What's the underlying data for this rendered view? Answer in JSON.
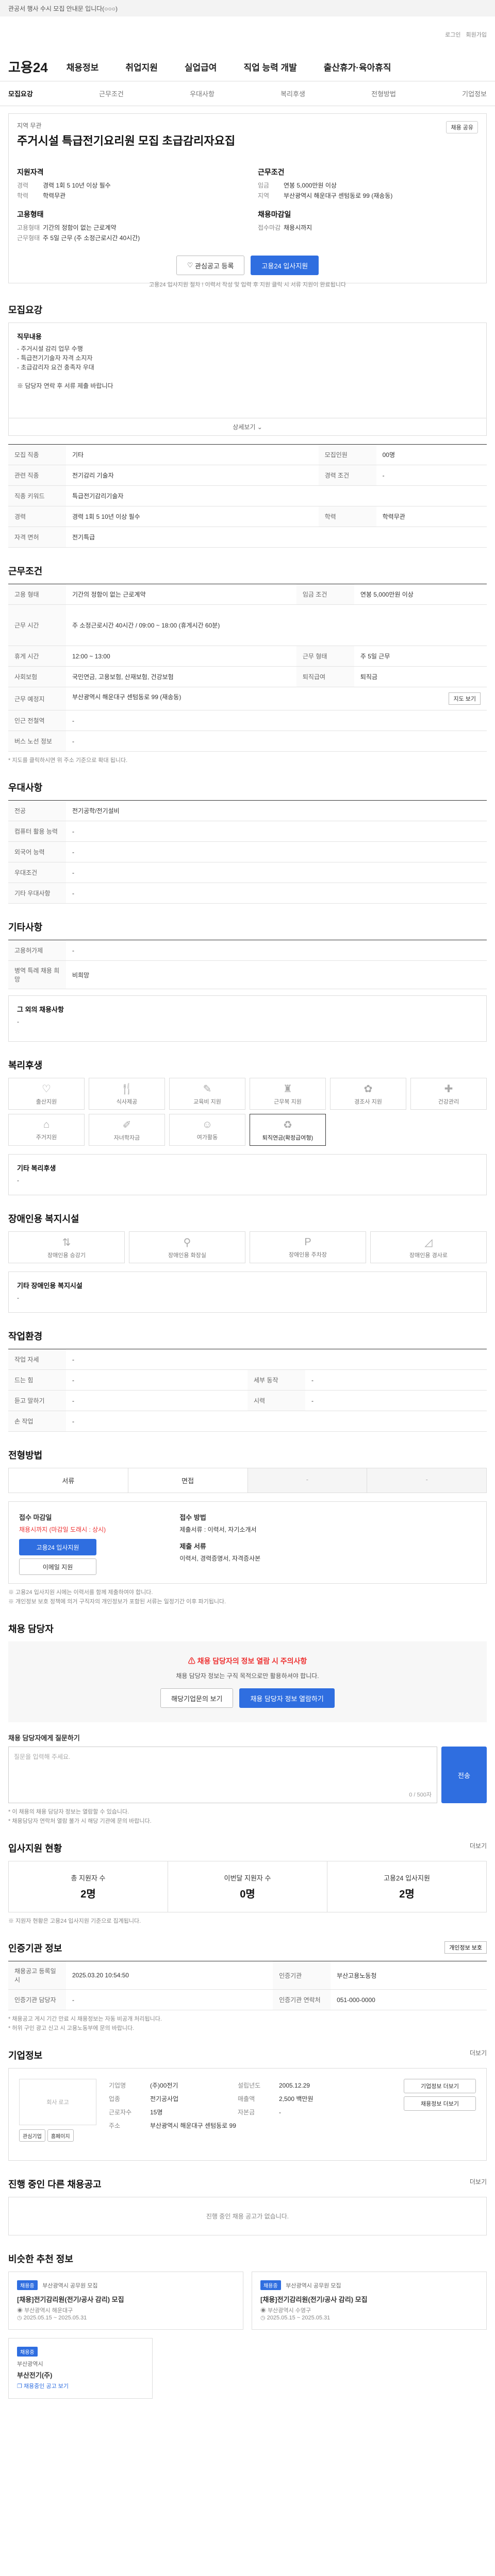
{
  "top": {
    "notice": "관공서 행사 수시 모집 안내문 입니다(○○○)",
    "util": [
      "로그인",
      "회원가입"
    ]
  },
  "gnb": {
    "logo": "고용24",
    "items": [
      "채용정보",
      "취업지원",
      "실업급여",
      "직업 능력 개발",
      "출산휴가·육아휴직"
    ]
  },
  "tabs": [
    "모집요강",
    "근무조건",
    "우대사항",
    "복리후생",
    "전형방법",
    "기업정보"
  ],
  "job": {
    "tag": "지역 무관",
    "share": "채용 공유",
    "title": "주거시설 특급전기요리원 모집 초급감리자요집",
    "left_title": "지원자격",
    "left": [
      {
        "k": "경력",
        "v": "경력 1회 5 10년 이상 필수"
      },
      {
        "k": "학력",
        "v": "학력무관"
      }
    ],
    "left_title2": "고용형태",
    "left2": [
      {
        "k": "고용형태",
        "v": "기간의 정함이 없는 근로계약"
      },
      {
        "k": "근무형태",
        "v": "주 5일 근무 (주 소정근로시간 40시간)"
      }
    ],
    "right_title": "근무조건",
    "right": [
      {
        "k": "임금",
        "v": "연봉 5,000만원 이상"
      },
      {
        "k": "지역",
        "v": "부산광역시 해운대구 센텀동로 99 (재송동)"
      }
    ],
    "right_title2": "채용마감일",
    "right2": [
      {
        "k": "접수마감",
        "v": "채용시까지"
      }
    ],
    "btn_fav": "관심공고 등록",
    "btn_apply": "고용24 입사지원",
    "hint": "고용24 입사지원 절차 ! 이력서 작성 및 입력 후 지원 클릭 시 서류 지원이 완료됩니다"
  },
  "recruit": {
    "title": "모집요강",
    "desc_head": "직무내용",
    "desc": "- 주거시설 감리 업무 수행\n- 특급전기기술자 자격 소지자\n- 초급감리자 요건 충족자 우대\n\n※ 담당자 연락 후 서류 제출 바랍니다",
    "more": "상세보기",
    "rows": [
      [
        "모집 직종",
        "기타",
        "모집인원",
        "00명"
      ],
      [
        "관련 직종",
        "전기감리 기술자",
        "경력 조건",
        "-"
      ],
      [
        "직종 키워드",
        "특급전기감리기술자",
        "",
        ""
      ],
      [
        "경력",
        "경력 1회 5 10년 이상 필수",
        "학력",
        "학력무관"
      ],
      [
        "자격 면허",
        "전기특급",
        "",
        ""
      ]
    ]
  },
  "cond": {
    "title": "근무조건",
    "rows": [
      [
        "고용 형태",
        "기간의 정함이 없는 근로계약",
        "임금 조건",
        "연봉 5,000만원 이상"
      ],
      [
        "근무 시간",
        "주 소정근로시간 40시간 / 09:00 ~ 18:00 (휴게시간 60분)",
        "",
        ""
      ],
      [
        "휴게 시간",
        "12:00 ~ 13:00",
        "근무 형태",
        "주 5일 근무"
      ],
      [
        "사회보험",
        "국민연금, 고용보험, 산재보험, 건강보험",
        "퇴직급여",
        "퇴직금"
      ],
      [
        "근무 예정지",
        "부산광역시 해운대구 센텀동로 99 (재송동)",
        "",
        ""
      ],
      [
        "인근 전철역",
        "-",
        "",
        ""
      ],
      [
        "버스 노선 정보",
        "-",
        "",
        ""
      ]
    ],
    "map_btn": "지도 보기",
    "note": "* 지도를 클릭하시면 위 주소 기준으로 확대 됩니다."
  },
  "pref": {
    "title": "우대사항",
    "rows": [
      [
        "전공",
        "전기공학/전기설비"
      ],
      [
        "컴퓨터 활용 능력",
        "-"
      ],
      [
        "외국어 능력",
        "-"
      ],
      [
        "우대조건",
        "-"
      ],
      [
        "기타 우대사항",
        "-"
      ]
    ]
  },
  "etc": {
    "title": "기타사항",
    "rows": [
      [
        "고용허가제",
        "-"
      ],
      [
        "병역 특례 채용 희망",
        "비희망"
      ]
    ],
    "extra_head": "그 외의 채용사항",
    "extra": "-"
  },
  "welfare": {
    "title": "복리후생",
    "items": [
      {
        "l": "출산지원",
        "on": false
      },
      {
        "l": "식사제공",
        "on": false
      },
      {
        "l": "교육비 지원",
        "on": false
      },
      {
        "l": "근무복 지원",
        "on": false
      },
      {
        "l": "경조사 지원",
        "on": false
      },
      {
        "l": "건강관리",
        "on": false
      },
      {
        "l": "주거지원",
        "on": false
      },
      {
        "l": "자녀학자금",
        "on": false
      },
      {
        "l": "여가활동",
        "on": false
      },
      {
        "l": "퇴직연금(확정급여형)",
        "on": true
      }
    ],
    "other_head": "기타 복리후생",
    "other": "-"
  },
  "disabled": {
    "title": "장애인용 복지시설",
    "items": [
      "장애인용 승강기",
      "장애인용 화장실",
      "장애인용 주차장",
      "장애인용 경사로"
    ],
    "other_head": "기타 장애인용 복지시설",
    "other": "-"
  },
  "work_env": {
    "title": "작업환경",
    "rows": [
      [
        "작업 자세",
        "-",
        "",
        ""
      ],
      [
        "드는 힘",
        "-",
        "세부 동작",
        "-"
      ],
      [
        "듣고 말하기",
        "-",
        "시력",
        "-"
      ],
      [
        "손 작업",
        "-",
        "",
        ""
      ]
    ]
  },
  "apply": {
    "title": "전형방법",
    "steps": [
      "서류",
      "면접",
      "-",
      "-"
    ],
    "method_head": "접수 마감일",
    "method": "채용시까지 (마감일 도래시 : 상시)",
    "btn_apply": "고용24 입사지원",
    "btn_email": "이메일 지원",
    "docs_head": "접수 방법",
    "docs": "제출서류 : 이력서, 자기소개서",
    "submit_head": "제출 서류",
    "submit": "이력서, 경력증명서, 자격증사본",
    "notes": [
      "※ 고용24 입사지원 시에는 이력서를 함께 제출하여야 합니다.",
      "※ 개인정보 보호 정책에 의거 구직자의 개인정보가 포함된 서류는 일정기간 이후 파기됩니다."
    ]
  },
  "contact": {
    "title": "채용 담당자",
    "warn": "채용 담당자의 정보 열람 시 주의사항",
    "desc": "채용 담당자 정보는 구직 목적으로만 활용하셔야 합니다.",
    "btn1": "채용 담당자 정보 열람하기",
    "btn2": "해당기업문의 보기",
    "ask_title": "채용 담당자에게 질문하기",
    "ask_ph": "질문을 입력해 주세요.",
    "ask_btn": "전송",
    "count": "0 / 500자",
    "notes": [
      "* 이 채용의 채용 담당자 정보는 열람할 수 있습니다.",
      "* 채용담당자 연락처 열람 불가 시 해당 기관에 문의 바랍니다."
    ]
  },
  "status": {
    "title": "입사지원 현황",
    "more": "더보기",
    "cols": [
      {
        "l": "총 지원자 수",
        "v": "2명"
      },
      {
        "l": "이번달 지원자 수",
        "v": "0명"
      },
      {
        "l": "고용24 입사지원",
        "v": "2명"
      }
    ],
    "note": "※ 지원자 현황은 고용24 입사지원 기준으로 집계됩니다."
  },
  "info": {
    "title": "인증기관 정보",
    "more": "개인정보 보호",
    "rows": [
      [
        "채용공고 등록일시",
        "2025.03.20 10:54:50",
        "인증기관",
        "부산고용노동청"
      ],
      [
        "인증기관 담당자",
        "-",
        "인증기관 연락처",
        "051-000-0000"
      ]
    ],
    "notes": [
      "* 채용공고 게시 기간 만료 시 채용정보는 자동 비공개 처리됩니다.",
      "* 허위 구인 광고 신고 시 고용노동부에 문의 바랍니다."
    ]
  },
  "company": {
    "title": "기업정보",
    "more": "더보기",
    "logo_txt": "회사 로고",
    "rows": [
      [
        "기업명",
        "(주)00전기",
        "설립년도",
        "2005.12.29"
      ],
      [
        "업종",
        "전기공사업",
        "매출액",
        "2,500 백만원"
      ],
      [
        "근로자수",
        "15명",
        "자본금",
        "-"
      ],
      [
        "주소",
        "부산광역시 해운대구 센텀동로 99",
        "",
        ""
      ]
    ],
    "btn_fav": "관심기업",
    "btn_home": "홈페이지",
    "btn1": "기업정보 더보기",
    "btn2": "채용정보 더보기"
  },
  "other_jobs": {
    "title": "진행 중인 다른 채용공고",
    "more": "더보기",
    "empty": "진행 중인 채용 공고가 없습니다."
  },
  "recommend": {
    "title": "비슷한 추천 정보",
    "items": [
      {
        "badge": "채용중",
        "org": "부산광역시 공무원 모집",
        "t": "[채용]전기감리원(전기/공사 감리) 모집",
        "d1": "부산광역시 해운대구",
        "d2": "2025.05.15 ~ 2025.05.31"
      },
      {
        "badge": "채용중",
        "org": "부산광역시 공무원 모집",
        "t": "[채용]전기감리원(전기/공사 감리) 모집",
        "d1": "부산광역시 수영구",
        "d2": "2025.05.15 ~ 2025.05.31"
      }
    ],
    "bottom_badge": "채용중",
    "bottom_org": "부산광역시",
    "bottom_t": "부산전기(주)",
    "bottom_link": "채용중인 공고 보기"
  }
}
